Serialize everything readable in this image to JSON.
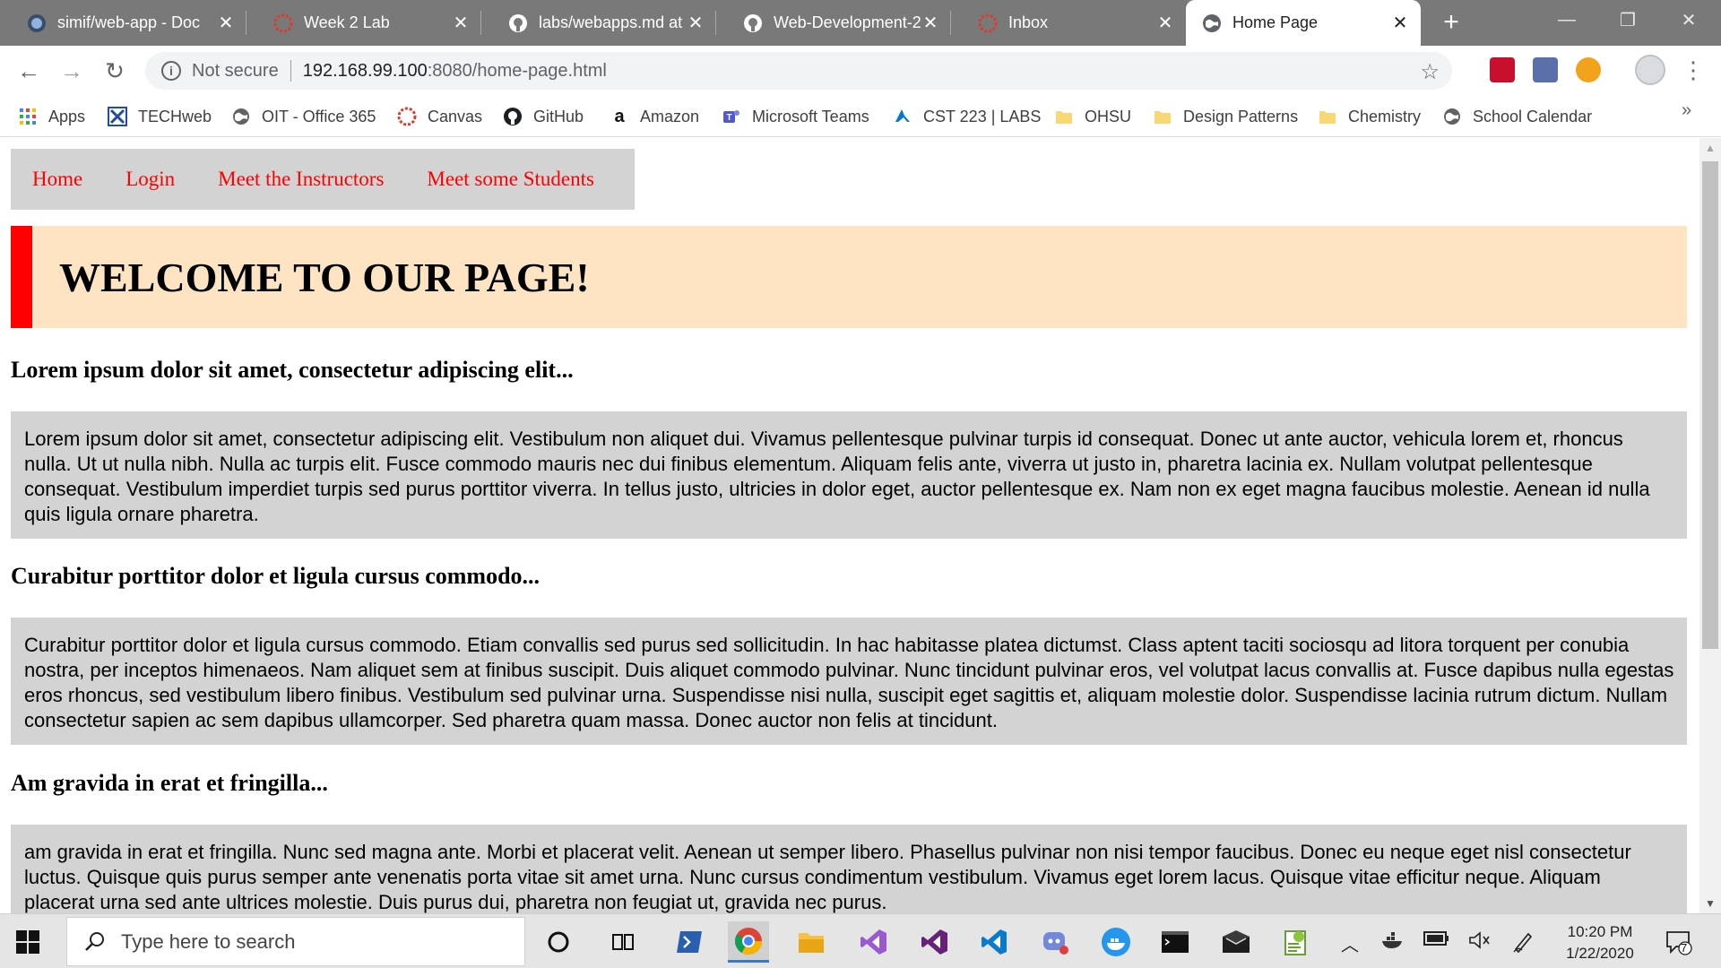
{
  "browser": {
    "tabs": [
      {
        "title": "simif/web-app - Doc",
        "icon": "docker-icon",
        "active": false
      },
      {
        "title": "Week 2 Lab",
        "icon": "canvas-icon",
        "active": false
      },
      {
        "title": "labs/webapps.md at",
        "icon": "github-icon",
        "active": false
      },
      {
        "title": "Web-Development-2",
        "icon": "github-icon",
        "active": false
      },
      {
        "title": "Inbox",
        "icon": "canvas-icon",
        "active": false
      },
      {
        "title": "Home Page",
        "icon": "globe-icon",
        "active": true
      }
    ],
    "new_tab_label": "+",
    "omnibox": {
      "security_text": "Not secure",
      "host": "192.168.99.100",
      "path": ":8080/home-page.html"
    },
    "bookmarks": [
      {
        "label": "Apps",
        "icon": "apps-grid-icon"
      },
      {
        "label": "TECHweb",
        "icon": "techweb-icon"
      },
      {
        "label": "OIT - Office 365",
        "icon": "globe-icon"
      },
      {
        "label": "Canvas",
        "icon": "canvas-icon"
      },
      {
        "label": "GitHub",
        "icon": "github-icon"
      },
      {
        "label": "Amazon",
        "icon": "amazon-icon"
      },
      {
        "label": "Microsoft Teams",
        "icon": "teams-icon"
      },
      {
        "label": "CST 223 | LABS",
        "icon": "azure-icon"
      },
      {
        "label": "OHSU",
        "icon": "folder-icon"
      },
      {
        "label": "Design Patterns",
        "icon": "folder-icon"
      },
      {
        "label": "Chemistry",
        "icon": "folder-icon"
      },
      {
        "label": "School Calendar",
        "icon": "globe-icon"
      }
    ],
    "bookmarks_more": "»"
  },
  "page": {
    "nav": [
      "Home",
      "Login",
      "Meet the Instructors",
      "Meet some Students"
    ],
    "welcome": "WELCOME TO OUR PAGE!",
    "sections": [
      {
        "heading": "Lorem ipsum dolor sit amet, consectetur adipiscing elit...",
        "body": "Lorem ipsum dolor sit amet, consectetur adipiscing elit. Vestibulum non aliquet dui. Vivamus pellentesque pulvinar turpis id consequat. Donec ut ante auctor, vehicula lorem et, rhoncus nulla. Ut ut nulla nibh. Nulla ac turpis elit. Fusce commodo mauris nec dui finibus elementum. Aliquam felis ante, viverra ut justo in, pharetra lacinia ex. Nullam volutpat pellentesque consequat. Vestibulum imperdiet turpis sed purus porttitor viverra. In tellus justo, ultricies in dolor eget, auctor pellentesque ex. Nam non ex eget magna faucibus molestie. Aenean id nulla quis ligula ornare pharetra."
      },
      {
        "heading": "Curabitur porttitor dolor et ligula cursus commodo...",
        "body": "Curabitur porttitor dolor et ligula cursus commodo. Etiam convallis sed purus sed sollicitudin. In hac habitasse platea dictumst. Class aptent taciti sociosqu ad litora torquent per conubia nostra, per inceptos himenaeos. Nam aliquet sem at finibus suscipit. Duis aliquet commodo pulvinar. Nunc tincidunt pulvinar eros, vel volutpat lacus convallis at. Fusce dapibus nulla egestas eros rhoncus, sed vestibulum libero finibus. Vestibulum sed pulvinar urna. Suspendisse nisi nulla, suscipit eget sagittis et, aliquam molestie dolor. Suspendisse lacinia rutrum dictum. Nullam consectetur sapien ac sem dapibus ullamcorper. Sed pharetra quam massa. Donec auctor non felis at tincidunt."
      },
      {
        "heading": "Am gravida in erat et fringilla...",
        "body": "am gravida in erat et fringilla. Nunc sed magna ante. Morbi et placerat velit. Aenean ut semper libero. Phasellus pulvinar non nisi tempor faucibus. Donec eu neque eget nisl consectetur luctus. Quisque quis purus semper ante venenatis porta vitae sit amet urna. Nunc cursus condimentum vestibulum. Vivamus eget lorem lacus. Quisque vitae efficitur neque. Aliquam placerat urna sed ante ultrices molestie. Duis purus dui, pharetra non feugiat ut, gravida nec purus."
      }
    ]
  },
  "taskbar": {
    "search_placeholder": "Type here to search",
    "time": "10:20 PM",
    "date": "1/22/2020",
    "notification_count": "7"
  },
  "colors": {
    "nav_link": "#ff0000",
    "nav_bg": "#d3d3d3",
    "welcome_bg": "#ffe4c4",
    "welcome_border": "#ff0000",
    "section_bg": "#d3d3d3",
    "tabstrip_bg": "#797979"
  }
}
